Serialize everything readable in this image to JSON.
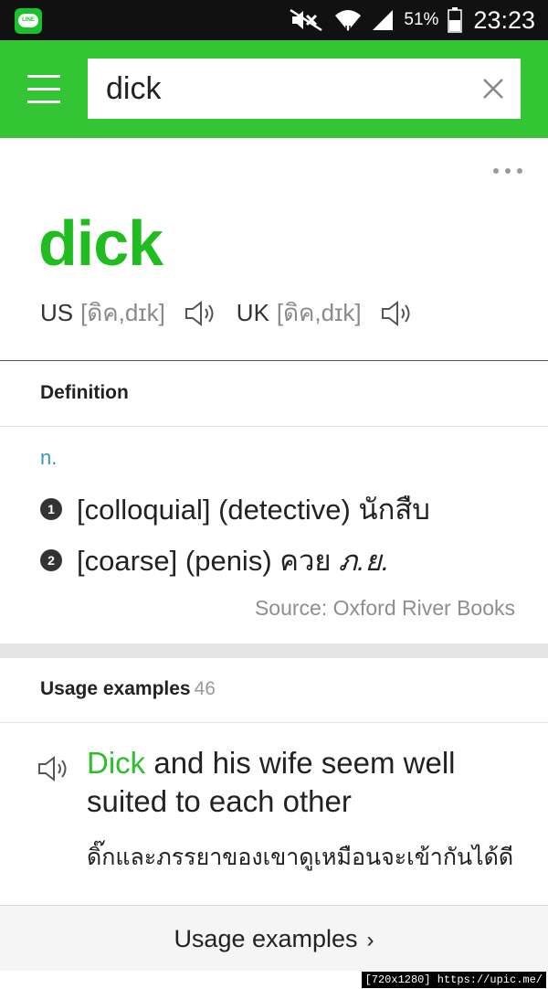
{
  "status_bar": {
    "battery_percent": "51%",
    "time": "23:23",
    "app_icon_label": "LINE"
  },
  "search": {
    "value": "dick"
  },
  "entry": {
    "headword": "dick",
    "pronunciations": [
      {
        "label": "US",
        "ipa": "[ดิค,dɪk]"
      },
      {
        "label": "UK",
        "ipa": "[ดิค,dɪk]"
      }
    ]
  },
  "definition": {
    "title": "Definition",
    "part_of_speech": "n.",
    "senses": [
      {
        "num": "1",
        "text": "[colloquial] (detective) นักสืบ",
        "extra": ""
      },
      {
        "num": "2",
        "text": "[coarse] (penis) ควย",
        "extra": "ภ.ย."
      }
    ],
    "source": "Source: Oxford River Books"
  },
  "usage": {
    "title": "Usage examples",
    "count": "46",
    "example_highlight": "Dick",
    "example_rest": " and his wife seem well suited to each other",
    "example_translation": "ดิ๊กและภรรยาของเขาดูเหมือนจะเข้ากันได้ดี"
  },
  "bottom": {
    "link_label": "Usage examples",
    "chevron": "›"
  },
  "watermark": "[720x1280] https://upic.me/",
  "colors": {
    "brand_green": "#33c533",
    "headword_green": "#1fbd1f",
    "pos_blue": "#3a97b4"
  }
}
